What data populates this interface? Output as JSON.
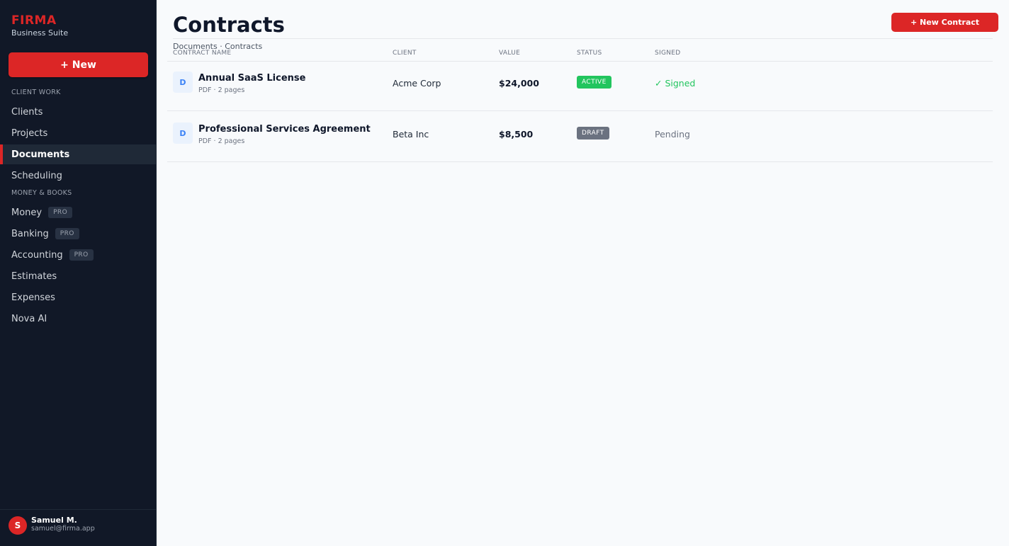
{
  "brand": {
    "name": "FIRMA",
    "subtitle": "Business Suite"
  },
  "sidebar": {
    "new_label": "+ New",
    "sections": [
      {
        "label": "CLIENT WORK",
        "items": [
          {
            "label": "Clients"
          },
          {
            "label": "Projects"
          },
          {
            "label": "Documents",
            "active": true
          },
          {
            "label": "Scheduling"
          }
        ]
      },
      {
        "label": "MONEY & BOOKS",
        "items": [
          {
            "label": "Money",
            "badge": "PRO"
          },
          {
            "label": "Banking",
            "badge": "PRO"
          },
          {
            "label": "Accounting",
            "badge": "PRO"
          },
          {
            "label": "Estimates"
          },
          {
            "label": "Expenses"
          },
          {
            "label": "Nova AI"
          }
        ]
      }
    ],
    "user": {
      "initial": "S",
      "name": "Samuel M.",
      "email": "samuel@firma.app"
    }
  },
  "main": {
    "title": "Contracts",
    "breadcrumb": "Documents · Contracts",
    "new_contract_label": "+ New Contract",
    "columns": {
      "name": "CONTRACT NAME",
      "client": "CLIENT",
      "value": "VALUE",
      "status": "STATUS",
      "signed": "SIGNED"
    },
    "rows": [
      {
        "icon": "D",
        "name": "Annual SaaS License",
        "meta": "PDF · 2 pages",
        "client": "Acme Corp",
        "value": "$24,000",
        "status": "ACTIVE",
        "status_color": "#22c55e",
        "signed": "✓ Signed",
        "signed_color": "#22c55e"
      },
      {
        "icon": "D",
        "name": "Professional Services Agreement",
        "meta": "PDF · 2 pages",
        "client": "Beta Inc",
        "value": "$8,500",
        "status": "DRAFT",
        "status_color": "#6b7280",
        "signed": "Pending",
        "signed_color": "#6b7280"
      }
    ]
  },
  "colors": {
    "accent": "#dc2626",
    "sidebar_bg": "#111827",
    "page_bg": "#f8fafc"
  }
}
